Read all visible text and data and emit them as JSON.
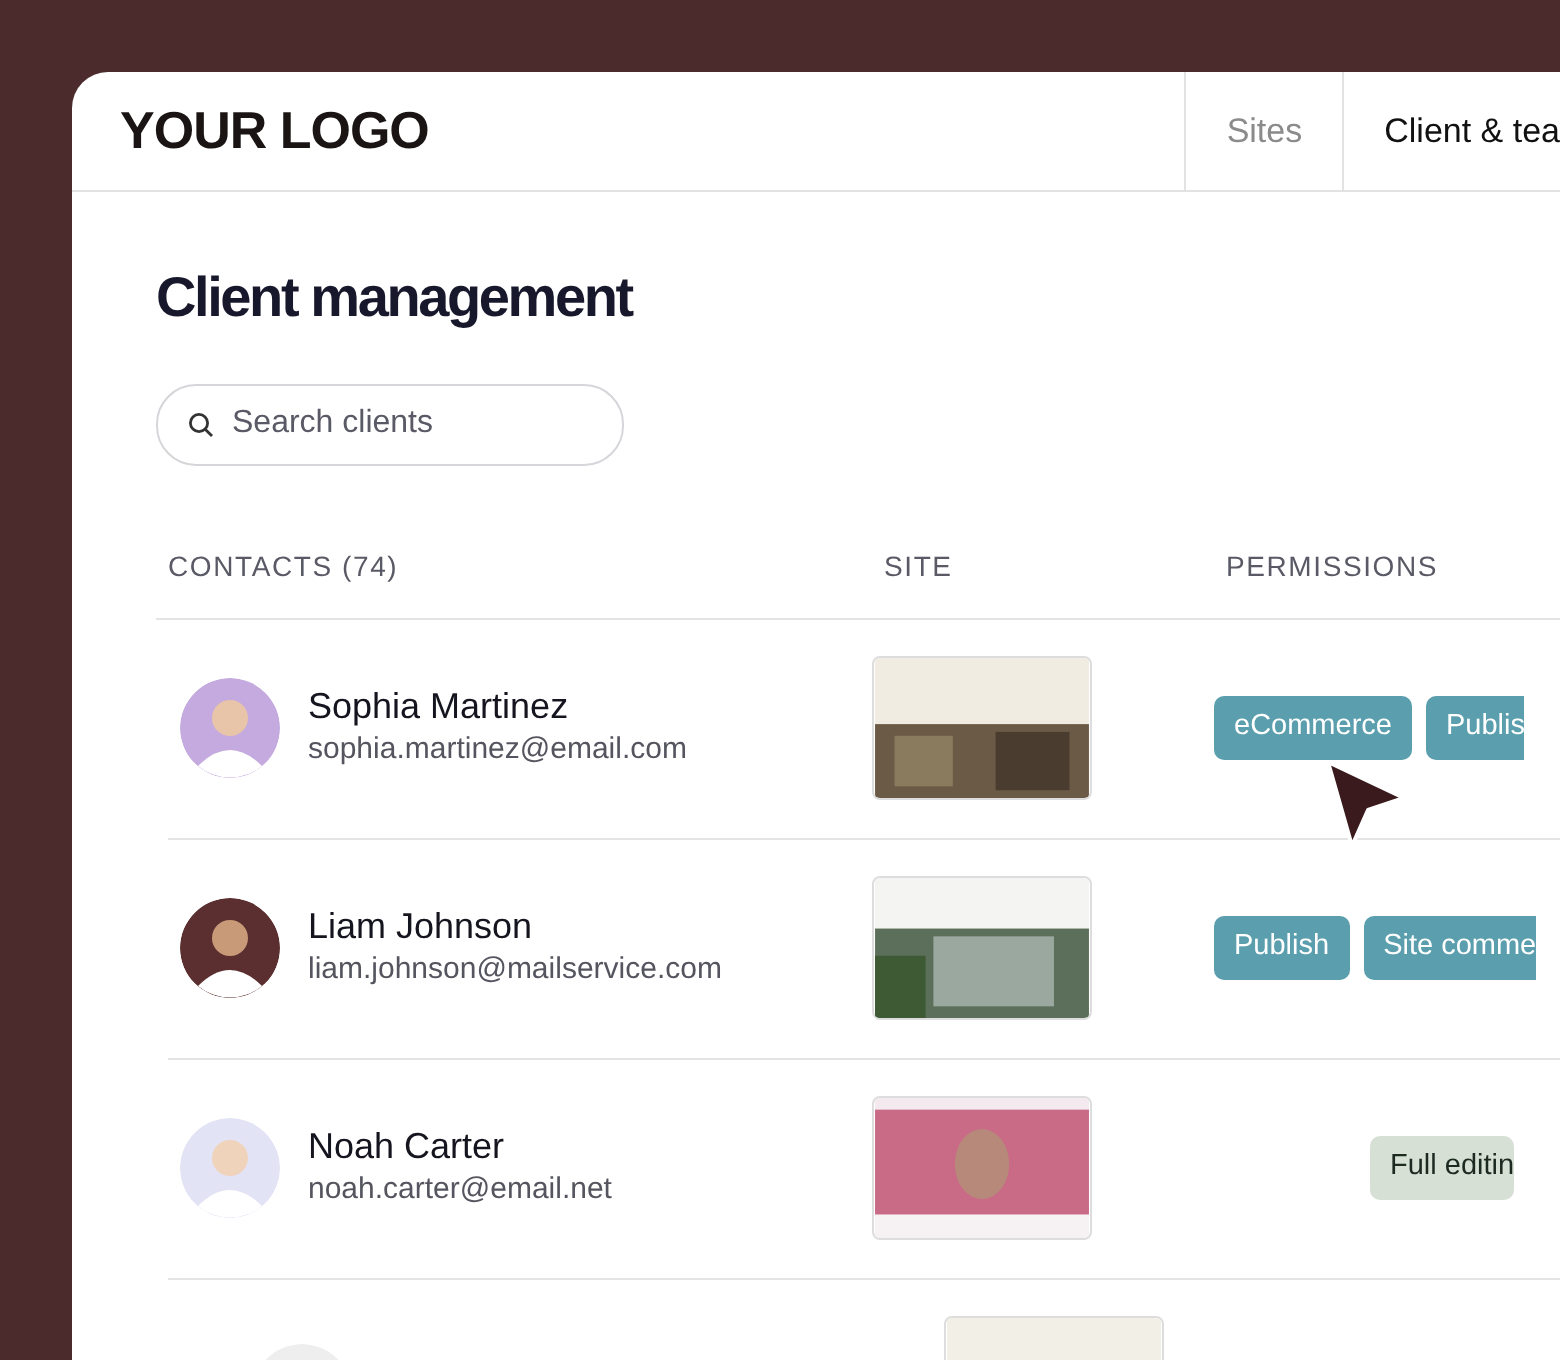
{
  "header": {
    "logo": "YOUR LOGO",
    "tabs": [
      {
        "label": "Sites",
        "selected": false
      },
      {
        "label": "Client & tea",
        "selected": true
      }
    ]
  },
  "page": {
    "title": "Client management",
    "search": {
      "placeholder": "Search clients"
    }
  },
  "table": {
    "columns": [
      "CONTACTS (74)",
      "SITE",
      "PERMISSIONS"
    ],
    "rows": [
      {
        "kind": "full",
        "name": "Sophia Martinez",
        "email": "sophia.martinez@email.com",
        "tags": [
          {
            "label": "eCommerce",
            "color": "#5b9fae"
          },
          {
            "label": "Publis",
            "color": "#5b9fae"
          }
        ]
      },
      {
        "kind": "full",
        "name": "Liam Johnson",
        "email": "liam.johnson@mailservice.com",
        "tags": [
          {
            "label": "Publish",
            "color": "#5b9fae"
          },
          {
            "label": "Site comme",
            "color": "#5b9fae"
          }
        ]
      },
      {
        "kind": "full",
        "name": "Noah Carter",
        "email": "noah.carter@email.net",
        "tags": [
          {
            "label": "Full editin",
            "color": "#d6e0d5"
          }
        ]
      },
      {
        "kind": "partial"
      }
    ]
  }
}
